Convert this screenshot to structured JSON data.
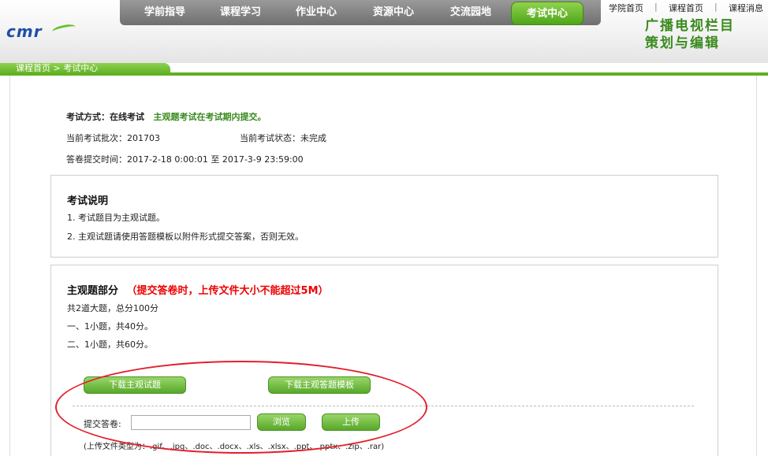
{
  "header": {
    "logo_text": "cmr",
    "nav": [
      "学前指导",
      "课程学习",
      "作业中心",
      "资源中心",
      "交流园地"
    ],
    "nav_active": "考试中心",
    "toplinks": [
      "学院首页",
      "|",
      "课程首页",
      "|",
      "课程消息"
    ],
    "course_title_line1": "广播电视栏目",
    "course_title_line2": "策划与编辑"
  },
  "breadcrumb": "课程首页 > 考试中心",
  "exam": {
    "mode_label": "考试方式：在线考试",
    "mode_note": "主观题考试在考试期内提交。",
    "batch_label": "当前考试批次：201703",
    "status_label": "当前考试状态：未完成",
    "time_label": "答卷提交时间：2017-2-18 0:00:01 至 2017-3-9 23:59:00"
  },
  "notes": {
    "title": "考试说明",
    "items": [
      "1. 考试题目为主观试题。",
      "2. 主观试题请使用答题模板以附件形式提交答案，否则无效。"
    ]
  },
  "subjective": {
    "title": "主观题部分",
    "warning": "（提交答卷时，上传文件大小不能超过5M）",
    "summary": "共2道大题，总分100分",
    "part1": "一、1小题，共40分。",
    "part2": "二、1小题，共60分。",
    "download_questions": "下载主观试题",
    "download_template": "下载主观答题模板",
    "submit_label": "提交答卷:",
    "browse": "浏览",
    "upload": "上传",
    "file_types": "(上传文件类型为：.gif、.jpg、.doc、.docx、.xls、.xlsx、.ppt、.pptx、.zip、.rar)"
  },
  "colors": {
    "accent_green": "#5fb023",
    "annotation_red": "#e2202b"
  }
}
